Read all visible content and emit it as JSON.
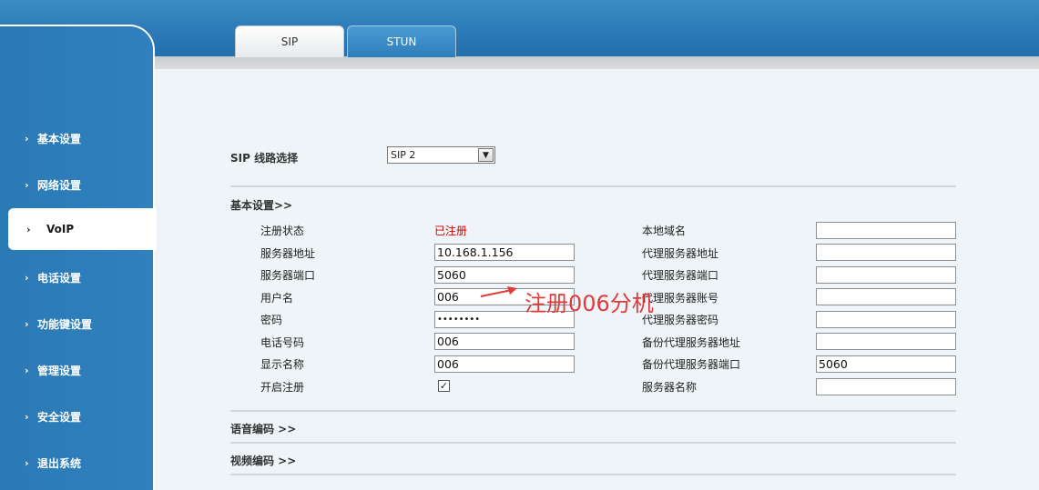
{
  "tabs": [
    {
      "label": "SIP"
    },
    {
      "label": "STUN"
    }
  ],
  "sidebar": {
    "items": [
      {
        "label": "基本设置"
      },
      {
        "label": "网络设置"
      },
      {
        "label": "VoIP"
      },
      {
        "label": "电话设置"
      },
      {
        "label": "功能键设置"
      },
      {
        "label": "管理设置"
      },
      {
        "label": "安全设置"
      },
      {
        "label": "退出系统"
      }
    ],
    "active_index": 2,
    "chevron": "›"
  },
  "line_select": {
    "label": "SIP 线路选择",
    "value": "SIP 2"
  },
  "basic_section": {
    "title": "基本设置>>",
    "left_fields": [
      {
        "label": "注册状态",
        "value": "已注册",
        "type": "status"
      },
      {
        "label": "服务器地址",
        "value": "10.168.1.156",
        "type": "input"
      },
      {
        "label": "服务器端口",
        "value": "5060",
        "type": "input"
      },
      {
        "label": "用户名",
        "value": "006",
        "type": "input"
      },
      {
        "label": "密码",
        "value": "••••••••",
        "type": "input"
      },
      {
        "label": "电话号码",
        "value": "006",
        "type": "input"
      },
      {
        "label": "显示名称",
        "value": "006",
        "type": "input"
      },
      {
        "label": "开启注册",
        "value": "✓",
        "type": "checkbox",
        "checked": true
      }
    ],
    "right_fields": [
      {
        "label": "本地域名",
        "value": ""
      },
      {
        "label": "代理服务器地址",
        "value": ""
      },
      {
        "label": "代理服务器端口",
        "value": ""
      },
      {
        "label": "代理服务器账号",
        "value": ""
      },
      {
        "label": "代理服务器密码",
        "value": ""
      },
      {
        "label": "备份代理服务器地址",
        "value": ""
      },
      {
        "label": "备份代理服务器端口",
        "value": "5060"
      },
      {
        "label": "服务器名称",
        "value": ""
      }
    ]
  },
  "sections": [
    {
      "label": "语音编码 >>"
    },
    {
      "label": "视频编码 >>"
    }
  ],
  "annotation": {
    "text": "注册006分机",
    "color": "#e23a3a"
  },
  "colors": {
    "header_blue": "#2a78b4",
    "status_red": "#d40000",
    "content_bg": "#eef4f8"
  }
}
